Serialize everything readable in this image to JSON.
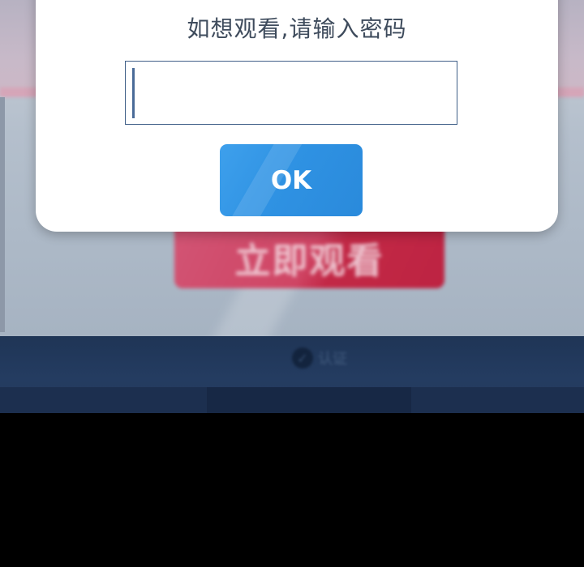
{
  "dialog": {
    "title": "如想观看,请输入密码",
    "password_value": "",
    "ok_label": "OK"
  },
  "background": {
    "watch_button_label": "立即观看",
    "footer_verify_text": "认证",
    "verify_icon": "check-circle-icon"
  },
  "colors": {
    "ok_button": "#2f92e3",
    "watch_button": "#d23b5c",
    "footer": "#243c61",
    "input_border": "#3f5e87"
  }
}
